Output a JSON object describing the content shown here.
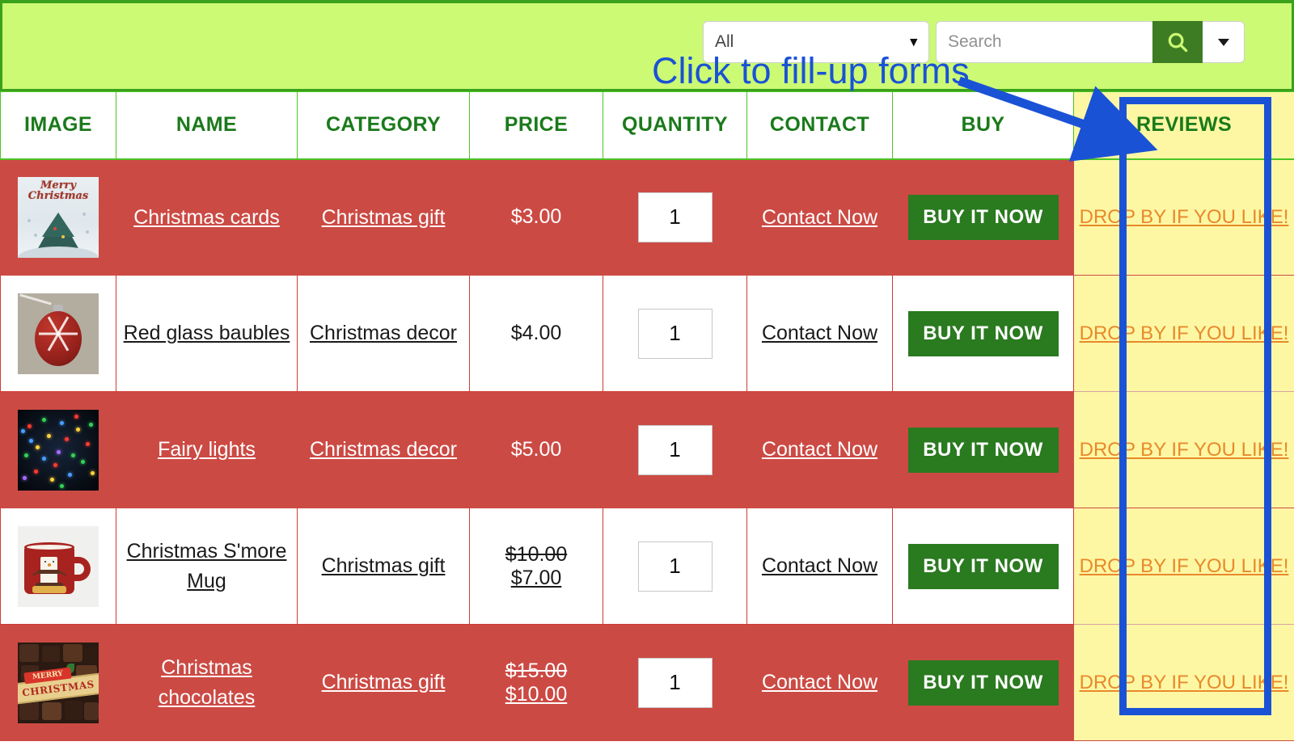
{
  "topbar": {
    "category_select": {
      "value": "All",
      "options": [
        "All"
      ]
    },
    "search": {
      "value": "",
      "placeholder": "Search"
    },
    "search_button_icon": "search-icon",
    "dropdown_toggle_icon": "caret-down-icon",
    "background_color": "#ccfa74",
    "accent_color": "#3d7c22"
  },
  "annotation": {
    "text": "Click to fill-up forms",
    "color": "#1a52d6",
    "highlight_target": "REVIEWS"
  },
  "table": {
    "headers": [
      "IMAGE",
      "NAME",
      "CATEGORY",
      "PRICE",
      "QUANTITY",
      "CONTACT",
      "BUY",
      "REVIEWS"
    ],
    "header_color": "#1a7a1a",
    "row_odd_bg": "#cc4a44",
    "row_even_bg": "#ffffff",
    "reviews_bg": "#fdf7a4",
    "review_link_color": "#e8892a",
    "buy_button_color": "#2a7a1f",
    "rows": [
      {
        "image_alt": "Merry Christmas card with decorated tree",
        "name": "Christmas cards",
        "category": "Christmas gift",
        "price": "$3.00",
        "price_old": "",
        "quantity": "1",
        "contact": "Contact Now",
        "buy": "BUY IT NOW",
        "review": "DROP BY IF YOU LIKE!"
      },
      {
        "image_alt": "Red glass bauble with white snowflake",
        "name": "Red glass baubles",
        "category": "Christmas decor",
        "price": "$4.00",
        "price_old": "",
        "quantity": "1",
        "contact": "Contact Now",
        "buy": "BUY IT NOW",
        "review": "DROP BY IF YOU LIKE!"
      },
      {
        "image_alt": "Multicolour fairy lights glowing in the dark",
        "name": "Fairy lights",
        "category": "Christmas decor",
        "price": "$5.00",
        "price_old": "",
        "quantity": "1",
        "contact": "Contact Now",
        "buy": "BUY IT NOW",
        "review": "DROP BY IF YOU LIKE!"
      },
      {
        "image_alt": "Red mug with snowman s'more design",
        "name": "Christmas S'more Mug",
        "category": "Christmas gift",
        "price": "$7.00",
        "price_old": "$10.00",
        "quantity": "1",
        "contact": "Contact Now",
        "buy": "BUY IT NOW",
        "review": "DROP BY IF YOU LIKE!"
      },
      {
        "image_alt": "Box of chocolates with Merry Christmas banner",
        "name": "Christmas chocolates",
        "category": "Christmas gift",
        "price": "$10.00",
        "price_old": "$15.00",
        "quantity": "1",
        "contact": "Contact Now",
        "buy": "BUY IT NOW",
        "review": "DROP BY IF YOU LIKE!"
      }
    ]
  }
}
